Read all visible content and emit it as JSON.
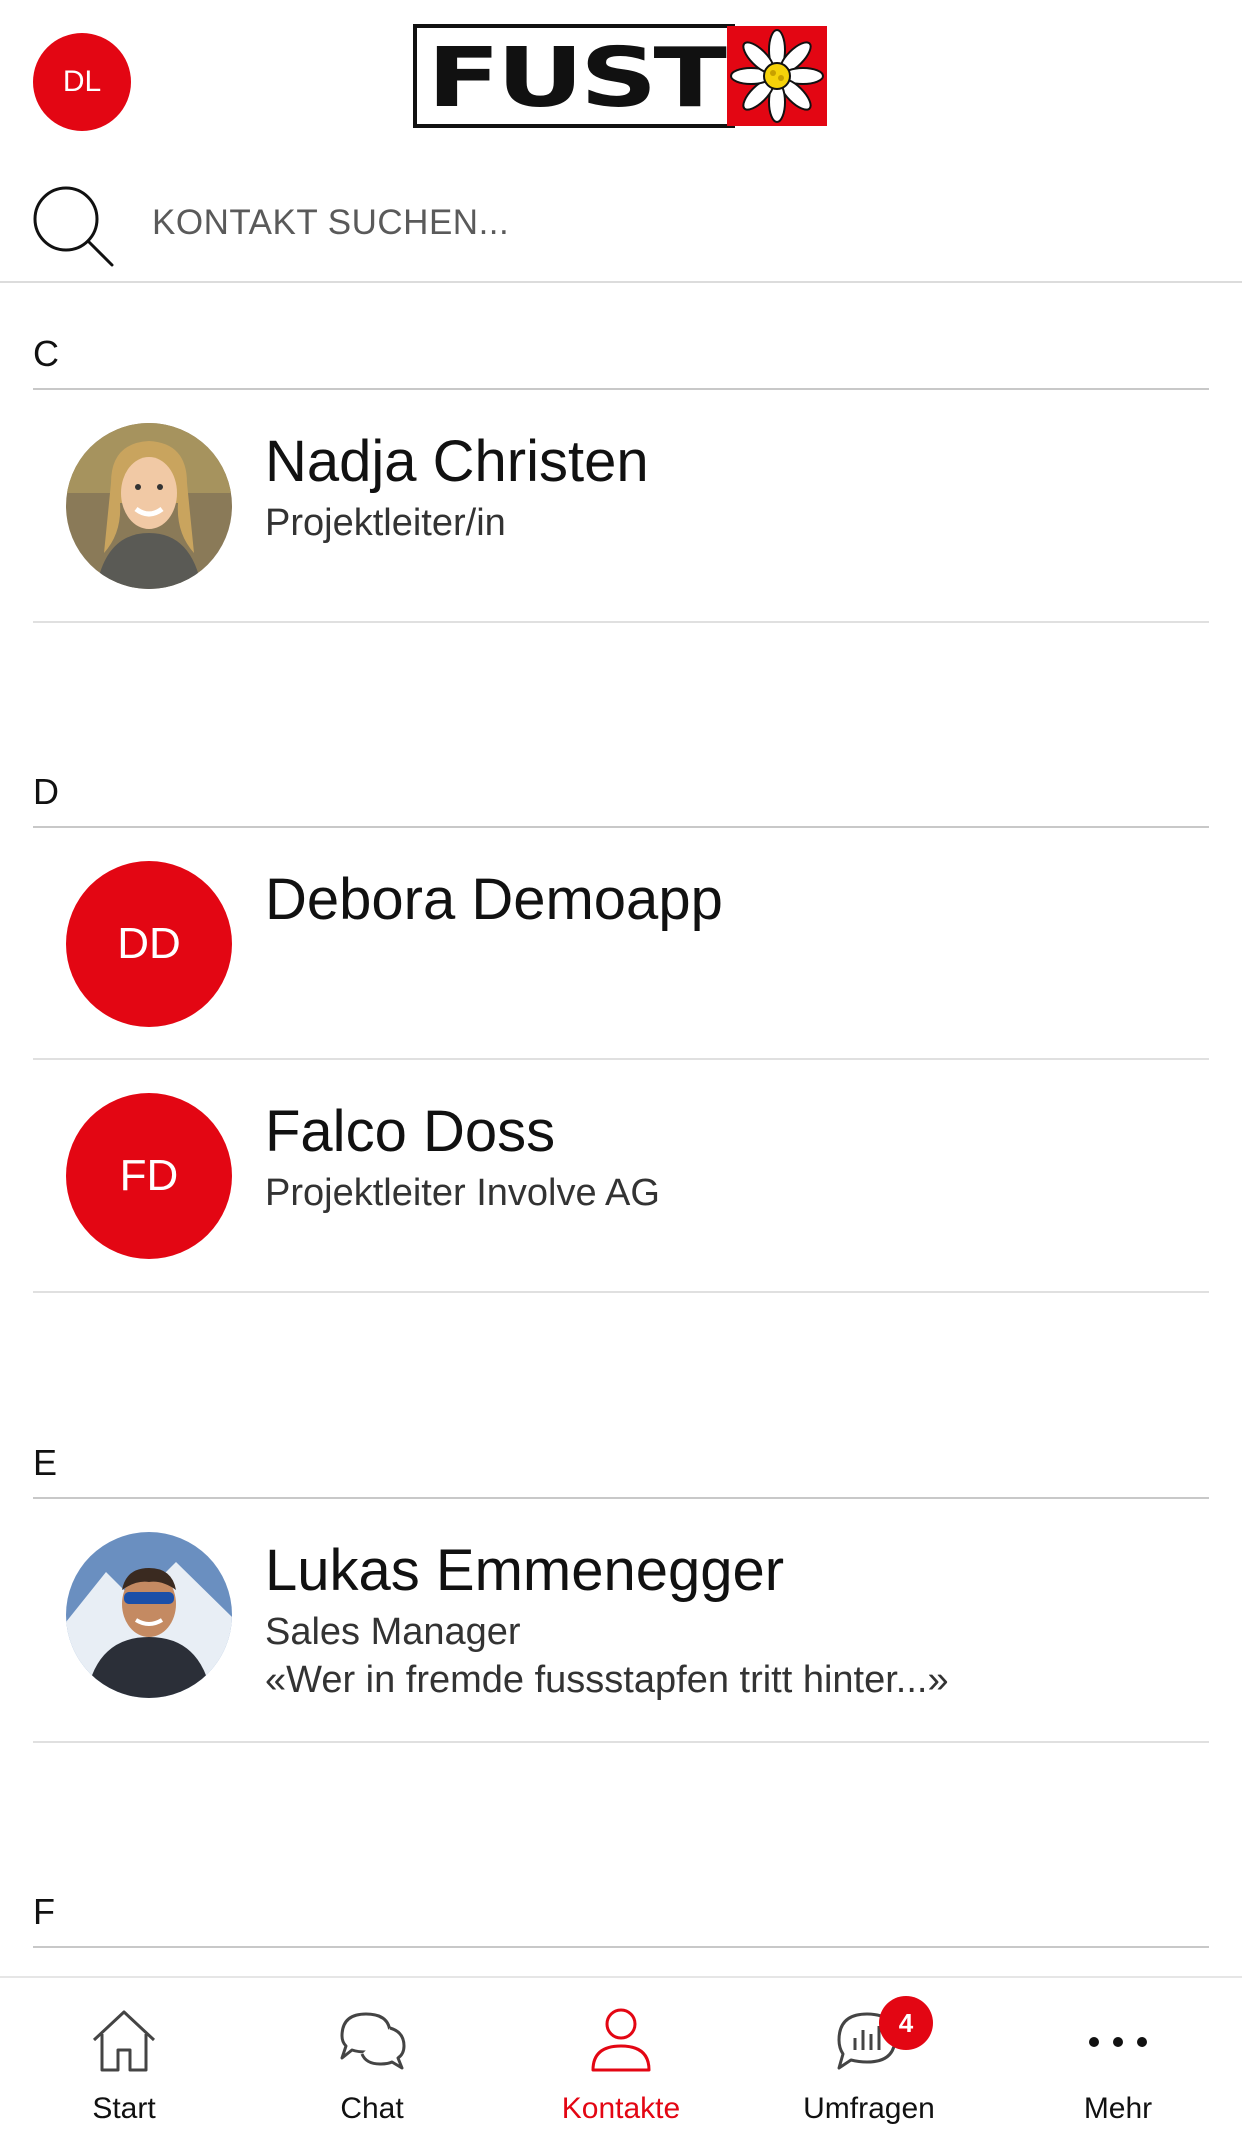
{
  "header": {
    "user_initials": "DL",
    "logo_text": "FUST"
  },
  "search": {
    "placeholder": "KONTAKT SUCHEN..."
  },
  "sections": [
    {
      "letter": "C",
      "contacts": [
        {
          "name": "Nadja Christen",
          "role": "Projektleiter/in",
          "avatar": "photo"
        }
      ]
    },
    {
      "letter": "D",
      "contacts": [
        {
          "name": "Debora Demoapp",
          "initials": "DD",
          "avatar": "initials"
        },
        {
          "name": "Falco Doss",
          "role": "Projektleiter Involve AG",
          "initials": "FD",
          "avatar": "initials"
        }
      ]
    },
    {
      "letter": "E",
      "contacts": [
        {
          "name": "Lukas Emmenegger",
          "role": "Sales Manager",
          "status": "«Wer in fremde fussstapfen tritt hinter...»",
          "avatar": "photo"
        }
      ]
    },
    {
      "letter": "F",
      "contacts": []
    }
  ],
  "bottom_nav": {
    "items": [
      {
        "label": "Start",
        "icon": "home-icon"
      },
      {
        "label": "Chat",
        "icon": "chat-icon"
      },
      {
        "label": "Kontakte",
        "icon": "person-icon",
        "active": true
      },
      {
        "label": "Umfragen",
        "icon": "poll-icon",
        "badge": "4"
      },
      {
        "label": "Mehr",
        "icon": "more-icon"
      }
    ]
  },
  "colors": {
    "accent": "#e30613",
    "divider": "#c8c8c8"
  }
}
